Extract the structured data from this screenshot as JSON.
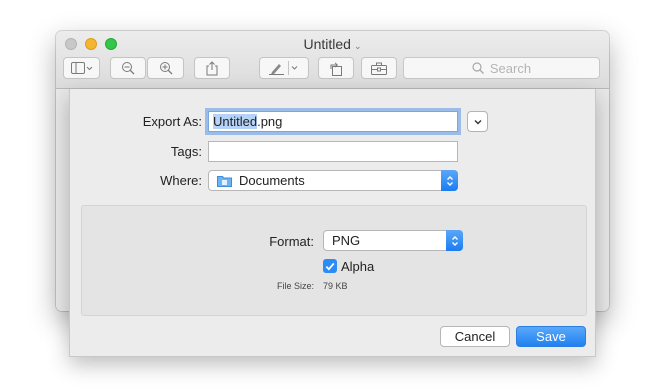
{
  "window": {
    "title": "Untitled",
    "search_placeholder": "Search"
  },
  "dialog": {
    "export_as_label": "Export As:",
    "filename_base": "Untitled",
    "filename_ext": ".png",
    "tags_label": "Tags:",
    "tags_value": "",
    "where_label": "Where:",
    "where_value": "Documents",
    "format_label": "Format:",
    "format_value": "PNG",
    "alpha_label": "Alpha",
    "alpha_checked": true,
    "filesize_label": "File Size:",
    "filesize_value": "79 KB",
    "cancel_label": "Cancel",
    "save_label": "Save"
  },
  "colors": {
    "accent": "#2a8cf5",
    "selection": "#b5d3f9"
  }
}
